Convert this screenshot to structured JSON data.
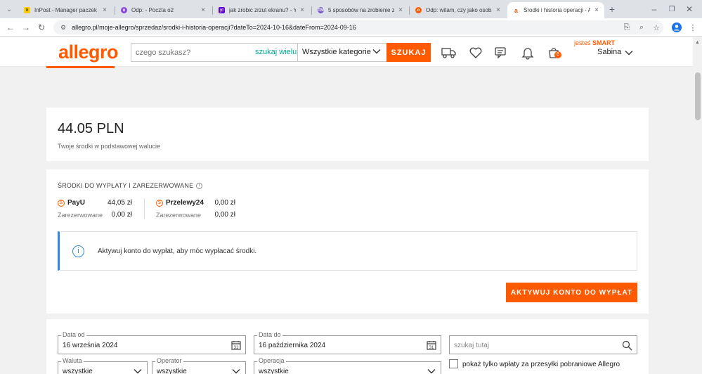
{
  "browser": {
    "tabs": [
      {
        "title": "InPost - Manager paczek",
        "favicon_color": "#ffcd00",
        "icon": "inpost-icon"
      },
      {
        "title": "Odp: - Poczta o2",
        "favicon_color": "#8a4bd8",
        "icon": "o2-icon"
      },
      {
        "title": "jak zrobic zrzut ekranu? - Yah",
        "favicon_color": "#6001d2",
        "icon": "yahoo-icon"
      },
      {
        "title": "5 sposobów na zrobienie zrzu",
        "favicon_color": "#7b5ec9",
        "icon": "tm-icon"
      },
      {
        "title": "Odp: witam, czy jako osoba",
        "favicon_color": "#ff5a00",
        "icon": "o2-icon"
      },
      {
        "title": "Środki i historia operacji - Al",
        "favicon_color": "#ff5a00",
        "icon": "allegro-icon"
      }
    ],
    "url": "allegro.pl/moje-allegro/sprzedaz/srodki-i-historia-operacji?dateTo=2024-10-16&dateFrom=2024-09-16"
  },
  "header": {
    "logo": "allegro",
    "search_placeholder": "czego szukasz?",
    "search_many": "szukaj wielu",
    "category": "Wszystkie kategorie",
    "search_button": "SZUKAJ",
    "cart_count": "6",
    "smart_prefix": "jesteś",
    "smart_label": "SMART",
    "user_name": "Sabina"
  },
  "balance": {
    "amount": "44.05 PLN",
    "subtitle": "Twoje środki w podstawowej walucie"
  },
  "payouts": {
    "title": "ŚRODKI DO WYPŁATY I ZAREZERWOWANE",
    "providers": [
      {
        "name": "PayU",
        "amount": "44,05 zł",
        "reserved_label": "Zarezerwowane",
        "reserved": "0,00 zł"
      },
      {
        "name": "Przelewy24",
        "amount": "0,00 zł",
        "reserved_label": "Zarezerwowane",
        "reserved": "0,00 zł"
      }
    ],
    "notice": "Aktywuj konto do wypłat, aby móc wypłacać środki.",
    "activate_button": "AKTYWUJ KONTO DO WYPŁAT"
  },
  "filters": {
    "date_from_label": "Data od",
    "date_from": "16 września 2024",
    "date_to_label": "Data do",
    "date_to": "16 października 2024",
    "search_placeholder": "szukaj tutaj",
    "currency_label": "Waluta",
    "currency": "wszystkie",
    "operator_label": "Operator",
    "operator": "wszystkie",
    "operation_label": "Operacja",
    "operation": "wszystkie",
    "cod_checkbox": "pokaż tylko wpłaty za przesyłki pobraniowe Allegro"
  }
}
